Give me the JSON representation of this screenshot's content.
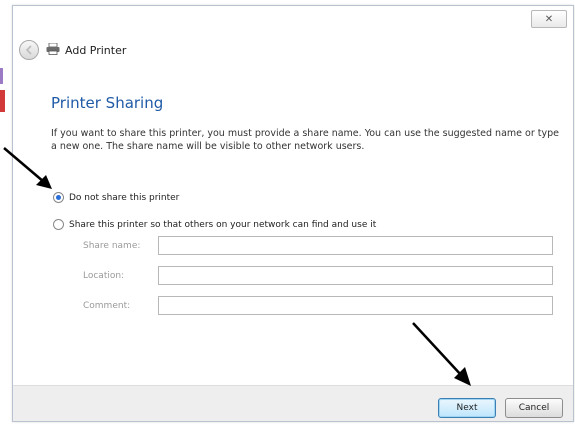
{
  "window": {
    "title": "Add Printer",
    "close_label": "✕"
  },
  "page": {
    "heading": "Printer Sharing",
    "description": "If you want to share this printer, you must provide a share name. You can use the suggested name or type a new one. The share name will be visible to other network users."
  },
  "options": {
    "do_not_share": {
      "label": "Do not share this printer",
      "selected": true
    },
    "share": {
      "label": "Share this printer so that others on your network can find and use it",
      "selected": false
    }
  },
  "fields": {
    "share_name": {
      "label": "Share name:",
      "value": ""
    },
    "location": {
      "label": "Location:",
      "value": ""
    },
    "comment": {
      "label": "Comment:",
      "value": ""
    }
  },
  "buttons": {
    "next": "Next",
    "cancel": "Cancel"
  },
  "colors": {
    "heading": "#1f5aa6",
    "primary_button": "#bee6fd",
    "annotation_arrow": "#000000"
  },
  "icons": [
    "back-arrow-icon",
    "printer-icon",
    "close-icon",
    "annotation-arrow-icon"
  ]
}
